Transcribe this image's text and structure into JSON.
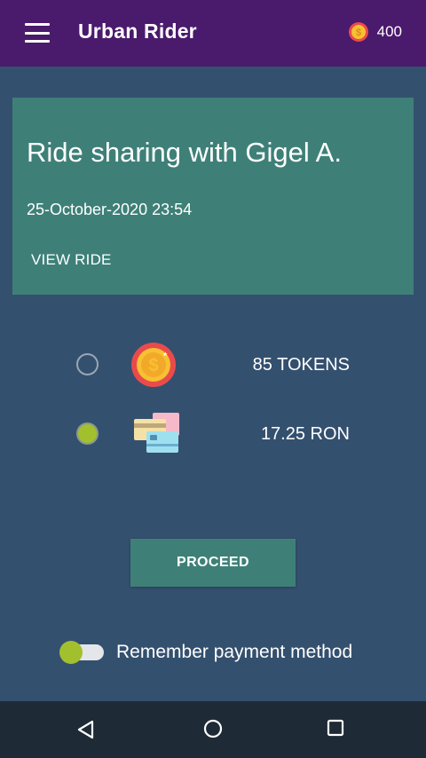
{
  "app_bar": {
    "title": "Urban Rider",
    "menu_icon": "hamburger-menu-icon",
    "coin_icon": "coin-icon",
    "coin_balance": "400"
  },
  "ride_card": {
    "title": "Ride sharing with Gigel A.",
    "datetime": "25-October-2020 23:54",
    "view_ride_label": "VIEW RIDE"
  },
  "payment_options": [
    {
      "label": "85 TOKENS",
      "icon": "coin-icon",
      "selected": false
    },
    {
      "label": "17.25 RON",
      "icon": "credit-cards-icon",
      "selected": true
    }
  ],
  "proceed_label": "PROCEED",
  "remember": {
    "label": "Remember payment method",
    "enabled": true
  },
  "colors": {
    "app_bar": "#4a1a6c",
    "background": "#34506f",
    "card": "#3e8078",
    "accent": "#a2bf2e",
    "nav_bar": "#1e2a36"
  },
  "system_nav": {
    "back_icon": "back-triangle-icon",
    "home_icon": "home-circle-icon",
    "recents_icon": "recents-square-icon"
  }
}
